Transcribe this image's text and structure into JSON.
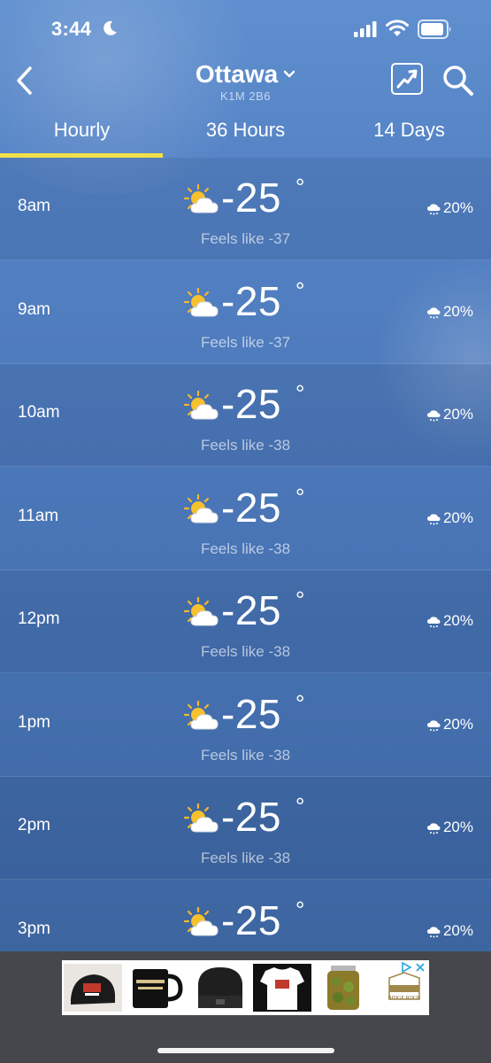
{
  "status_bar": {
    "time": "3:44",
    "icons": [
      "moon-icon",
      "signal-icon",
      "wifi-icon",
      "battery-icon"
    ]
  },
  "header": {
    "city": "Ottawa",
    "postal_code": "K1M 2B6",
    "icons": [
      "back-icon",
      "chevron-down-icon",
      "trend-chart-icon",
      "search-icon"
    ]
  },
  "tabs": [
    {
      "label": "Hourly",
      "selected": true
    },
    {
      "label": "36 Hours",
      "selected": false
    },
    {
      "label": "14 Days",
      "selected": false
    }
  ],
  "accent_color": "#f2e04a",
  "hours": [
    {
      "time": "8am",
      "temp": "-25",
      "feels": "Feels like -37",
      "precip": "20%"
    },
    {
      "time": "9am",
      "temp": "-25",
      "feels": "Feels like -37",
      "precip": "20%"
    },
    {
      "time": "10am",
      "temp": "-25",
      "feels": "Feels like -38",
      "precip": "20%"
    },
    {
      "time": "11am",
      "temp": "-25",
      "feels": "Feels like -38",
      "precip": "20%"
    },
    {
      "time": "12pm",
      "temp": "-25",
      "feels": "Feels like -38",
      "precip": "20%"
    },
    {
      "time": "1pm",
      "temp": "-25",
      "feels": "Feels like -38",
      "precip": "20%"
    },
    {
      "time": "2pm",
      "temp": "-25",
      "feels": "Feels like -38",
      "precip": "20%"
    },
    {
      "time": "3pm",
      "temp": "-25",
      "feels": "",
      "precip": "20%"
    }
  ],
  "degree_symbol": "°",
  "ad": {
    "items": [
      "cap",
      "enamel mug",
      "beanie",
      "t-shirt",
      "pickle jar",
      "logo"
    ],
    "brand_text": "RIDGE ROCK"
  }
}
